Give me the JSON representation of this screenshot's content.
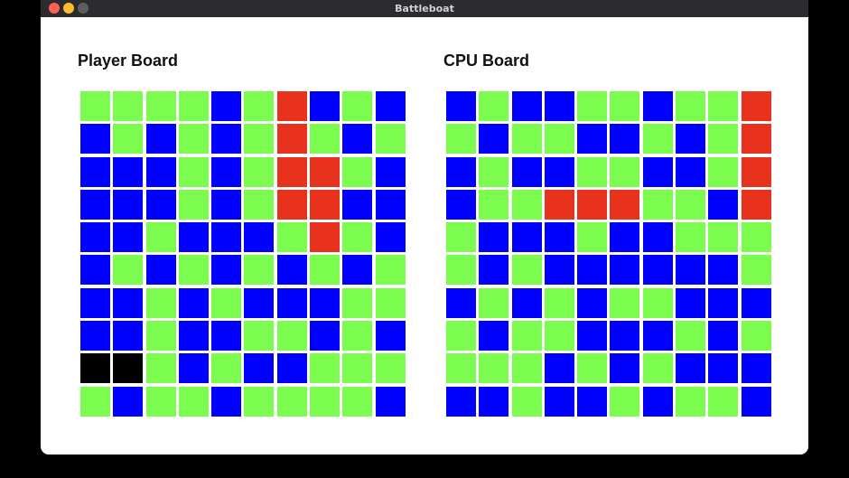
{
  "window": {
    "title": "Battleboat"
  },
  "colors": {
    "legend": {
      "B": "#0000ff",
      "G": "#7cfc4e",
      "R": "#e8321e",
      "K": "#000000"
    }
  },
  "player_board": {
    "title": "Player Board",
    "rows": [
      "GGGGBGRBGB",
      "BGBGBGRGBG",
      "BBBGBGRRGB",
      "BBBGBGRRBB",
      "BBGBBBGRGB",
      "BGBGBGBGBG",
      "BBGBGBBBGG",
      "BBGBBGGBGB",
      "KKGBGBBGGG",
      "GBGGBGGGGB"
    ]
  },
  "cpu_board": {
    "title": "CPU Board",
    "rows": [
      "BGBBGGBGGR",
      "GBGGBBGBGR",
      "BGBBGGBBGR",
      "BGGRRRGGBR",
      "GBBBGBBGGG",
      "GBGBBBBBBG",
      "BGBGBGGBBB",
      "GBGGBBBGBG",
      "GGGBGBGBBB",
      "BBGBBGBGGB"
    ]
  }
}
